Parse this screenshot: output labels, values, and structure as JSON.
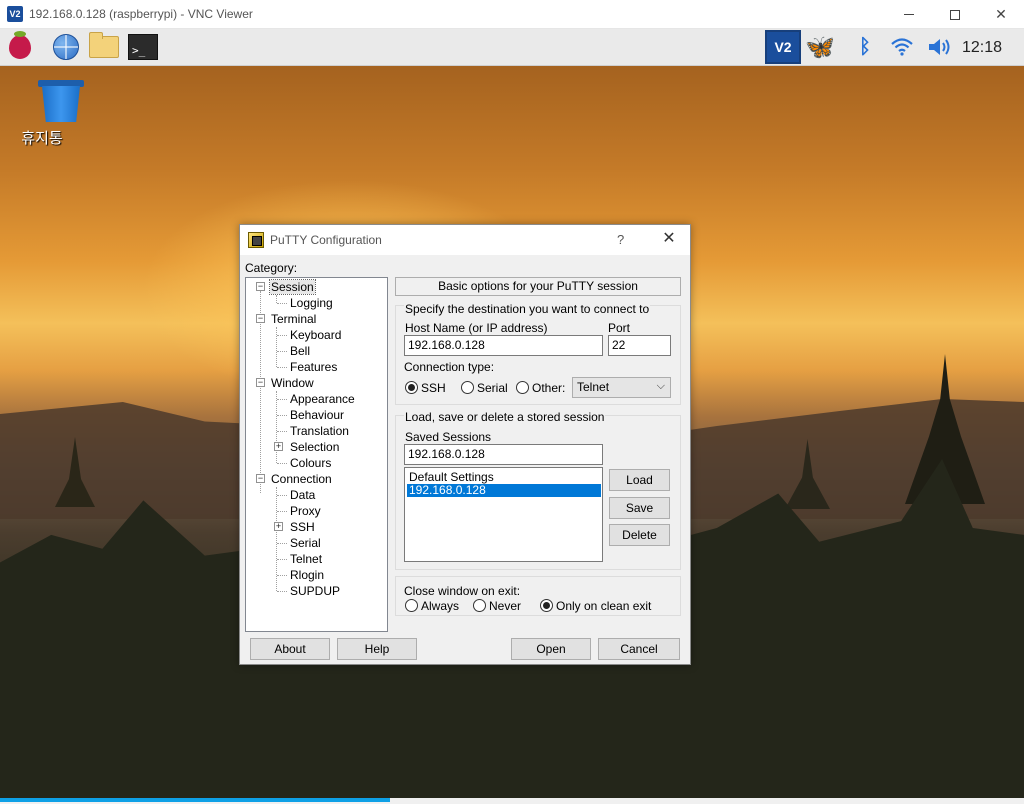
{
  "vnc_window": {
    "logo_text": "V2",
    "title": "192.168.0.128 (raspberrypi) - VNC Viewer",
    "minimize": "—",
    "maximize": "☐",
    "close": "✕"
  },
  "taskbar": {
    "apps": [
      "raspberry-menu",
      "web-browser",
      "file-manager",
      "terminal"
    ],
    "terminal_prompt": ">_",
    "tray": [
      "vnc-server",
      "butterfly-app",
      "bluetooth",
      "wifi",
      "volume"
    ],
    "vnc_tray_text": "V2",
    "clock": "12:18"
  },
  "desktop": {
    "trash_label": "휴지통"
  },
  "putty": {
    "title": "PuTTY Configuration",
    "help_btn": "?",
    "close_btn": "✕",
    "category_label": "Category:",
    "tree": [
      {
        "label": "Session",
        "expander": "minus",
        "selected": true
      },
      {
        "label": "Logging"
      },
      {
        "label": "Terminal",
        "expander": "minus"
      },
      {
        "label": "Keyboard"
      },
      {
        "label": "Bell"
      },
      {
        "label": "Features"
      },
      {
        "label": "Window",
        "expander": "minus"
      },
      {
        "label": "Appearance"
      },
      {
        "label": "Behaviour"
      },
      {
        "label": "Translation"
      },
      {
        "label": "Selection",
        "expander": "plus"
      },
      {
        "label": "Colours"
      },
      {
        "label": "Connection",
        "expander": "minus"
      },
      {
        "label": "Data"
      },
      {
        "label": "Proxy"
      },
      {
        "label": "SSH",
        "expander": "plus"
      },
      {
        "label": "Serial"
      },
      {
        "label": "Telnet"
      },
      {
        "label": "Rlogin"
      },
      {
        "label": "SUPDUP"
      }
    ],
    "panel_header": "Basic options for your PuTTY session",
    "destination": {
      "group_label": "Specify the destination you want to connect to",
      "host_label": "Host Name (or IP address)",
      "host_value": "192.168.0.128",
      "port_label": "Port",
      "port_value": "22",
      "conn_type_label": "Connection type:",
      "conn_types": [
        {
          "label": "SSH",
          "checked": true
        },
        {
          "label": "Serial",
          "checked": false
        },
        {
          "label": "Other:",
          "checked": false
        }
      ],
      "other_select_value": "Telnet"
    },
    "sessions": {
      "group_label": "Load, save or delete a stored session",
      "saved_label": "Saved Sessions",
      "saved_value": "192.168.0.128",
      "list": [
        {
          "label": "Default Settings",
          "selected": false
        },
        {
          "label": "192.168.0.128",
          "selected": true
        }
      ],
      "load_btn": "Load",
      "save_btn": "Save",
      "delete_btn": "Delete"
    },
    "close_on_exit": {
      "label": "Close window on exit:",
      "options": [
        {
          "label": "Always",
          "checked": false
        },
        {
          "label": "Never",
          "checked": false
        },
        {
          "label": "Only on clean exit",
          "checked": true
        }
      ]
    },
    "buttons": {
      "about": "About",
      "help": "Help",
      "open": "Open",
      "cancel": "Cancel"
    }
  }
}
